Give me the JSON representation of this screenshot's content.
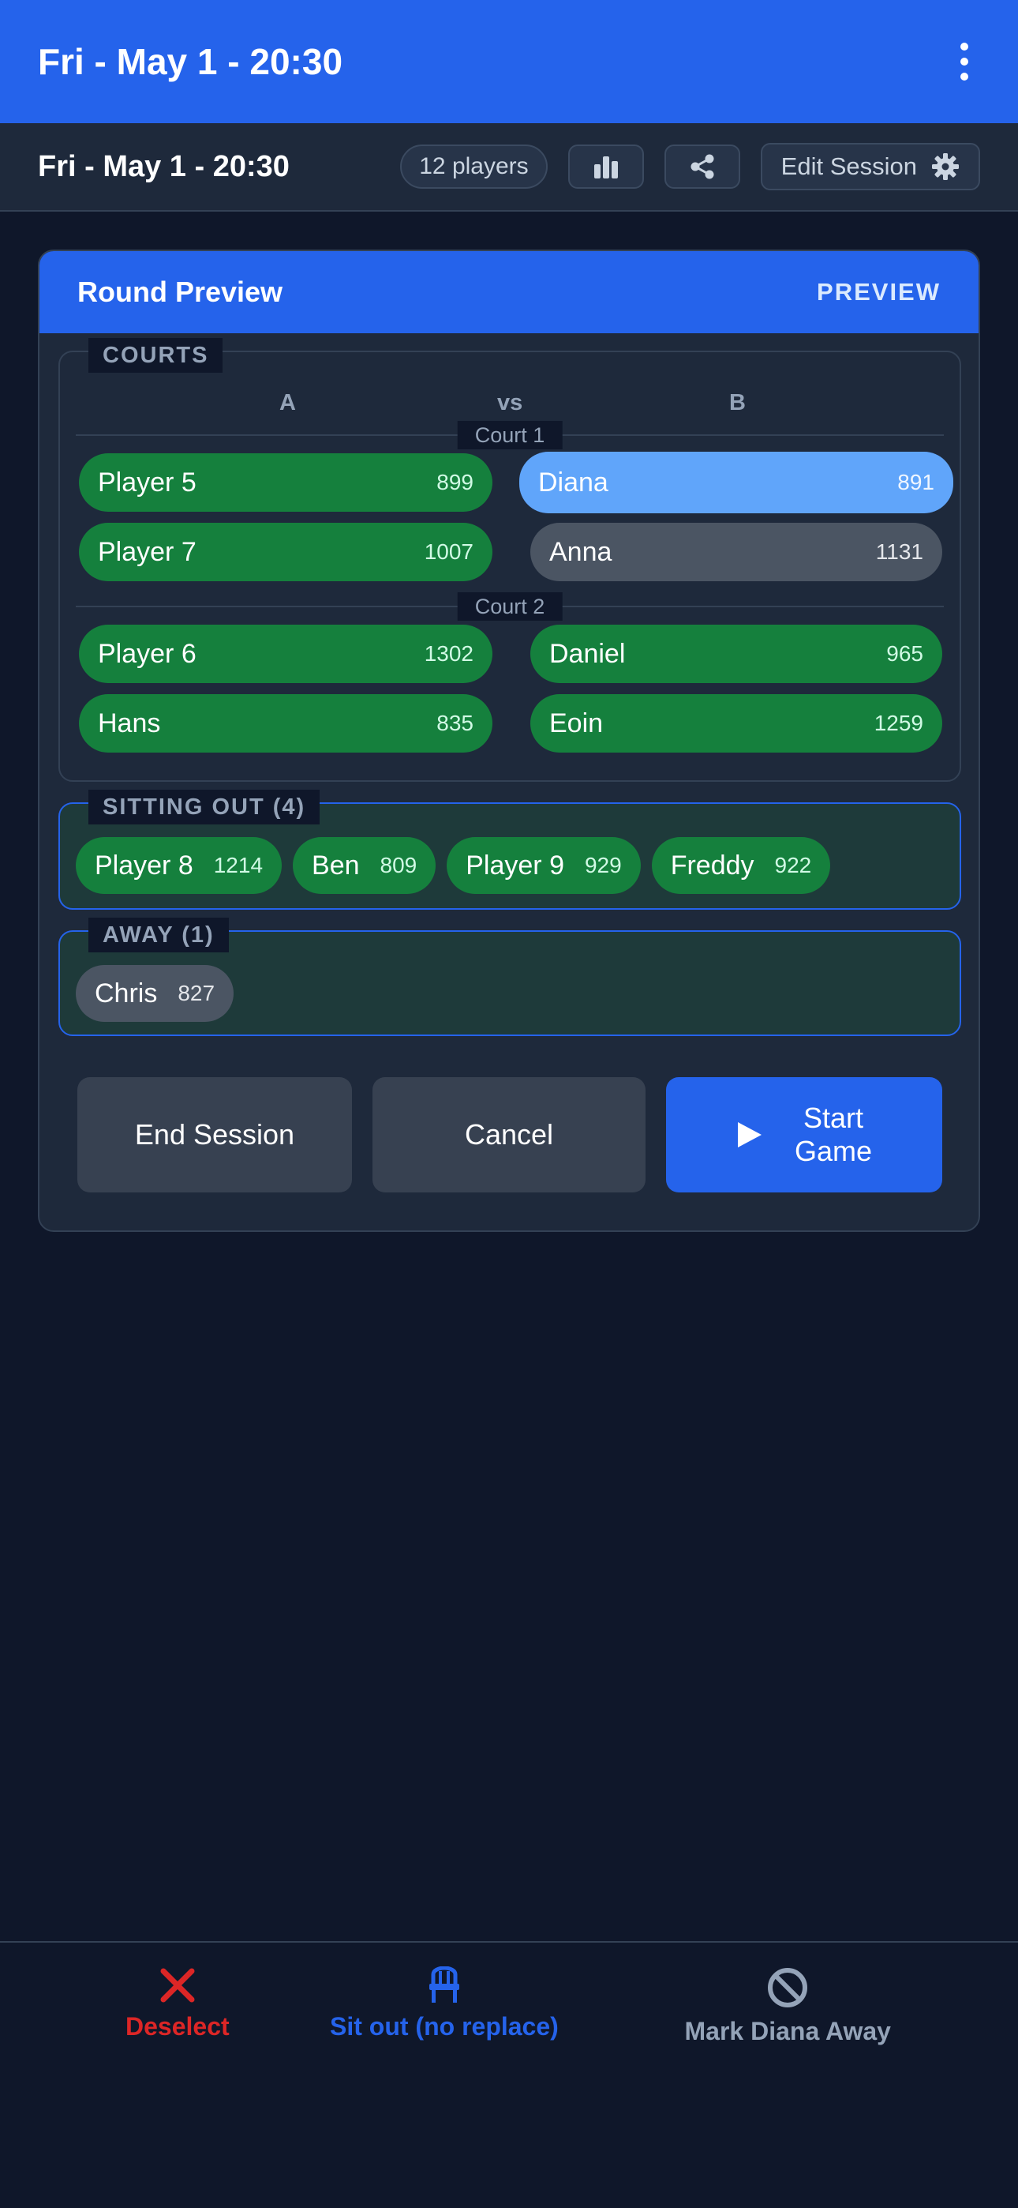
{
  "appbar": {
    "title": "Fri - May 1 - 20:30"
  },
  "subbar": {
    "title": "Fri - May 1 - 20:30",
    "players_label": "12 players",
    "edit_label": "Edit Session"
  },
  "preview": {
    "title": "Round Preview",
    "tag": "PREVIEW",
    "courts_legend": "COURTS",
    "team_a": "A",
    "vs": "vs",
    "team_b": "B",
    "courts": [
      {
        "label": "Court 1",
        "team_a": [
          {
            "name": "Player 5",
            "rating": "899"
          },
          {
            "name": "Player 7",
            "rating": "1007"
          }
        ],
        "team_b": [
          {
            "name": "Diana",
            "rating": "891"
          },
          {
            "name": "Anna",
            "rating": "1131"
          }
        ]
      },
      {
        "label": "Court 2",
        "team_a": [
          {
            "name": "Player 6",
            "rating": "1302"
          },
          {
            "name": "Hans",
            "rating": "835"
          }
        ],
        "team_b": [
          {
            "name": "Daniel",
            "rating": "965"
          },
          {
            "name": "Eoin",
            "rating": "1259"
          }
        ]
      }
    ],
    "sitting_out_legend": "SITTING OUT (4)",
    "sitting_out": [
      {
        "name": "Player 8",
        "rating": "1214"
      },
      {
        "name": "Ben",
        "rating": "809"
      },
      {
        "name": "Player 9",
        "rating": "929"
      },
      {
        "name": "Freddy",
        "rating": "922"
      }
    ],
    "away_legend": "AWAY (1)",
    "away": [
      {
        "name": "Chris",
        "rating": "827"
      }
    ],
    "end_label": "End Session",
    "cancel_label": "Cancel",
    "start_line1": "Start",
    "start_line2": "Game"
  },
  "bottom_nav": {
    "deselect": "Deselect",
    "sit_out": "Sit out (no replace)",
    "mark_away": "Mark Diana Away"
  },
  "colors": {
    "primary": "#2563eb",
    "present": "#15803d",
    "selected": "#60a5fa",
    "away": "#4b5563",
    "danger": "#dc2626"
  }
}
